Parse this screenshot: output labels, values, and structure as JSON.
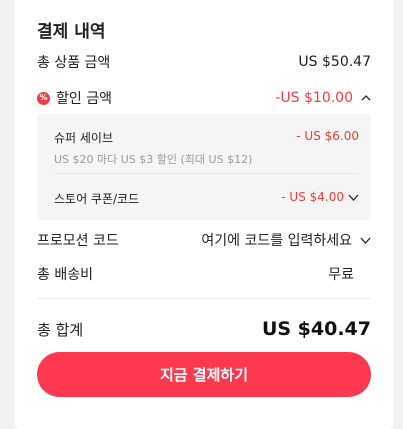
{
  "section_title": "결제 내역",
  "subtotal": {
    "label": "총 상품 금액",
    "value": "US $50.47"
  },
  "discount": {
    "icon": "%",
    "label": "할인 금액",
    "value": "-US $10.00",
    "details": [
      {
        "name": "슈퍼 세이브",
        "sub": "US $20 마다 US $3 할인 (최대 US $12)",
        "value": "- US $6.00"
      },
      {
        "name": "스토어 쿠폰/코드",
        "value": "- US $4.00"
      }
    ]
  },
  "promo": {
    "label": "프로모션 코드",
    "placeholder": "여기에 코드를 입력하세요"
  },
  "shipping": {
    "label": "총 배송비",
    "value": "무료"
  },
  "total": {
    "label": "총 합계",
    "value": "US $40.47"
  },
  "pay_button": "지금 결제하기",
  "colors": {
    "accent": "#f23d3d",
    "button": "#fd384f"
  }
}
